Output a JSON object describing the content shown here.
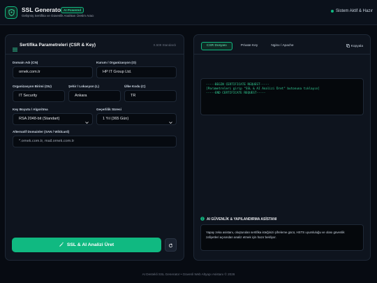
{
  "header": {
    "title": "SSL Generator",
    "badge": "AI Powered",
    "subtitle": "Gelişmiş Sertifika ve Güvenlik Anahtarı Üretim Aracı",
    "status": "Sistem Aktif & Hazır"
  },
  "form": {
    "title": "Sertifika Parametreleri (CSR & Key)",
    "note": "X.509 Standardı",
    "fields": {
      "domain": {
        "label": "Domain Adı (CN)",
        "value": "ornek.com.tr"
      },
      "org": {
        "label": "Kurum / Organizasyon (O)",
        "value": "HP IT Group Ltd."
      },
      "unit": {
        "label": "Organizasyon Birimi (OU)",
        "value": "IT Security"
      },
      "city": {
        "label": "Şehir / Lokasyon (L)",
        "value": "Ankara"
      },
      "country": {
        "label": "Ülke Kodu (C)",
        "value": "TR"
      },
      "keysize": {
        "label": "Key Boyutu / Algoritma",
        "value": "RSA 2048-bit (Standart)"
      },
      "validity": {
        "label": "Geçerlilik Süresi",
        "value": "1 Yıl (365 Gün)"
      },
      "san": {
        "label": "Alternatif Domainler (SAN / Wildcard)",
        "placeholder": "*.ornek.com.tr, mail.ornek.com.tr"
      }
    },
    "generate_label": "SSL & AI Analizi Üret"
  },
  "output": {
    "tabs": [
      "CSR Dosyası",
      "Private Key",
      "Nginx / Apache"
    ],
    "active_tab": 0,
    "copy_label": "Kopyala",
    "code_lines": [
      "-----BEGIN CERTIFICATE REQUEST-----",
      "[Parametreleri girip \"SSL & AI Analizi Üret\" butonuna tıklayın]",
      "-----END CERTIFICATE REQUEST-----"
    ],
    "ai_title": "AI GÜVENLİK & YAPILANDIRMA ASİSTANI",
    "ai_text": "Yapay zeka asistanı, oluşturulan sertifika isteğinizi şifreleme gücü, HSTS uyumluluğu ve olası güvenlik zafiyetleri açısından analiz etmek için hazır bekliyor."
  },
  "footer": "AI Destekli SSL Generator • Güvenli Web Altyapı Asistanı © 2026",
  "colors": {
    "accent": "#10b981",
    "background": "#070b12",
    "panel": "#0e141e"
  }
}
